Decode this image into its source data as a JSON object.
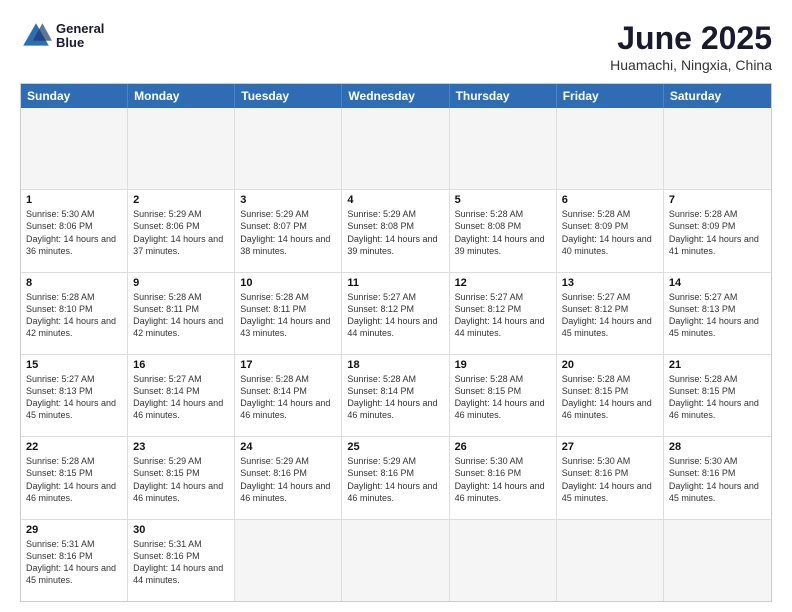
{
  "logo": {
    "line1": "General",
    "line2": "Blue"
  },
  "title": "June 2025",
  "subtitle": "Huamachi, Ningxia, China",
  "calendar": {
    "headers": [
      "Sunday",
      "Monday",
      "Tuesday",
      "Wednesday",
      "Thursday",
      "Friday",
      "Saturday"
    ],
    "rows": [
      [
        {
          "day": "",
          "empty": true
        },
        {
          "day": "",
          "empty": true
        },
        {
          "day": "",
          "empty": true
        },
        {
          "day": "",
          "empty": true
        },
        {
          "day": "",
          "empty": true
        },
        {
          "day": "",
          "empty": true
        },
        {
          "day": "",
          "empty": true
        }
      ],
      [
        {
          "day": "1",
          "sunrise": "5:30 AM",
          "sunset": "8:06 PM",
          "daylight": "14 hours and 36 minutes."
        },
        {
          "day": "2",
          "sunrise": "5:29 AM",
          "sunset": "8:06 PM",
          "daylight": "14 hours and 37 minutes."
        },
        {
          "day": "3",
          "sunrise": "5:29 AM",
          "sunset": "8:07 PM",
          "daylight": "14 hours and 38 minutes."
        },
        {
          "day": "4",
          "sunrise": "5:29 AM",
          "sunset": "8:08 PM",
          "daylight": "14 hours and 39 minutes."
        },
        {
          "day": "5",
          "sunrise": "5:28 AM",
          "sunset": "8:08 PM",
          "daylight": "14 hours and 39 minutes."
        },
        {
          "day": "6",
          "sunrise": "5:28 AM",
          "sunset": "8:09 PM",
          "daylight": "14 hours and 40 minutes."
        },
        {
          "day": "7",
          "sunrise": "5:28 AM",
          "sunset": "8:09 PM",
          "daylight": "14 hours and 41 minutes."
        }
      ],
      [
        {
          "day": "8",
          "sunrise": "5:28 AM",
          "sunset": "8:10 PM",
          "daylight": "14 hours and 42 minutes."
        },
        {
          "day": "9",
          "sunrise": "5:28 AM",
          "sunset": "8:11 PM",
          "daylight": "14 hours and 42 minutes."
        },
        {
          "day": "10",
          "sunrise": "5:28 AM",
          "sunset": "8:11 PM",
          "daylight": "14 hours and 43 minutes."
        },
        {
          "day": "11",
          "sunrise": "5:27 AM",
          "sunset": "8:12 PM",
          "daylight": "14 hours and 44 minutes."
        },
        {
          "day": "12",
          "sunrise": "5:27 AM",
          "sunset": "8:12 PM",
          "daylight": "14 hours and 44 minutes."
        },
        {
          "day": "13",
          "sunrise": "5:27 AM",
          "sunset": "8:12 PM",
          "daylight": "14 hours and 45 minutes."
        },
        {
          "day": "14",
          "sunrise": "5:27 AM",
          "sunset": "8:13 PM",
          "daylight": "14 hours and 45 minutes."
        }
      ],
      [
        {
          "day": "15",
          "sunrise": "5:27 AM",
          "sunset": "8:13 PM",
          "daylight": "14 hours and 45 minutes."
        },
        {
          "day": "16",
          "sunrise": "5:27 AM",
          "sunset": "8:14 PM",
          "daylight": "14 hours and 46 minutes."
        },
        {
          "day": "17",
          "sunrise": "5:28 AM",
          "sunset": "8:14 PM",
          "daylight": "14 hours and 46 minutes."
        },
        {
          "day": "18",
          "sunrise": "5:28 AM",
          "sunset": "8:14 PM",
          "daylight": "14 hours and 46 minutes."
        },
        {
          "day": "19",
          "sunrise": "5:28 AM",
          "sunset": "8:15 PM",
          "daylight": "14 hours and 46 minutes."
        },
        {
          "day": "20",
          "sunrise": "5:28 AM",
          "sunset": "8:15 PM",
          "daylight": "14 hours and 46 minutes."
        },
        {
          "day": "21",
          "sunrise": "5:28 AM",
          "sunset": "8:15 PM",
          "daylight": "14 hours and 46 minutes."
        }
      ],
      [
        {
          "day": "22",
          "sunrise": "5:28 AM",
          "sunset": "8:15 PM",
          "daylight": "14 hours and 46 minutes."
        },
        {
          "day": "23",
          "sunrise": "5:29 AM",
          "sunset": "8:15 PM",
          "daylight": "14 hours and 46 minutes."
        },
        {
          "day": "24",
          "sunrise": "5:29 AM",
          "sunset": "8:16 PM",
          "daylight": "14 hours and 46 minutes."
        },
        {
          "day": "25",
          "sunrise": "5:29 AM",
          "sunset": "8:16 PM",
          "daylight": "14 hours and 46 minutes."
        },
        {
          "day": "26",
          "sunrise": "5:30 AM",
          "sunset": "8:16 PM",
          "daylight": "14 hours and 46 minutes."
        },
        {
          "day": "27",
          "sunrise": "5:30 AM",
          "sunset": "8:16 PM",
          "daylight": "14 hours and 45 minutes."
        },
        {
          "day": "28",
          "sunrise": "5:30 AM",
          "sunset": "8:16 PM",
          "daylight": "14 hours and 45 minutes."
        }
      ],
      [
        {
          "day": "29",
          "sunrise": "5:31 AM",
          "sunset": "8:16 PM",
          "daylight": "14 hours and 45 minutes."
        },
        {
          "day": "30",
          "sunrise": "5:31 AM",
          "sunset": "8:16 PM",
          "daylight": "14 hours and 44 minutes."
        },
        {
          "day": "",
          "empty": true
        },
        {
          "day": "",
          "empty": true
        },
        {
          "day": "",
          "empty": true
        },
        {
          "day": "",
          "empty": true
        },
        {
          "day": "",
          "empty": true
        }
      ]
    ]
  }
}
